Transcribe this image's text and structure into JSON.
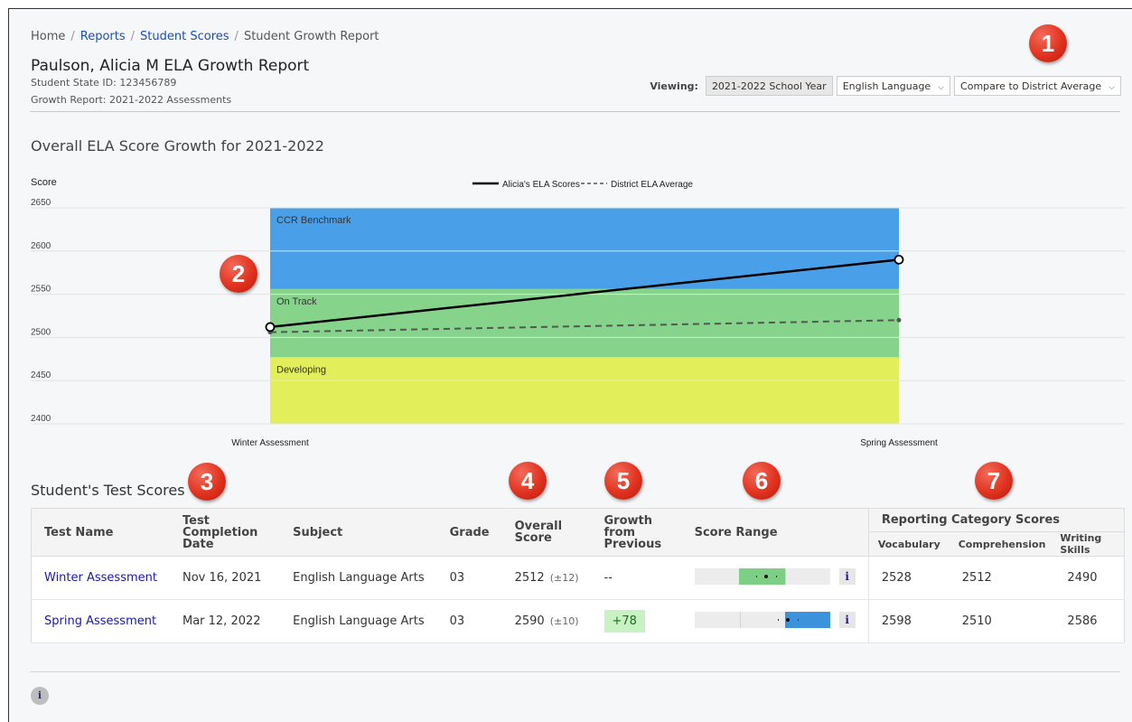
{
  "breadcrumb": {
    "home": "Home",
    "reports": "Reports",
    "student_scores": "Student Scores",
    "current": "Student Growth Report",
    "separator": "/"
  },
  "header": {
    "title": "Paulson, Alicia M ELA Growth Report",
    "state_id": "Student State ID: 123456789",
    "growth_report": "Growth Report: 2021-2022 Assessments"
  },
  "viewing": {
    "label": "Viewing:",
    "year": "2021-2022 School Year",
    "subject": "English Language",
    "compare": "Compare to District Average"
  },
  "chart_section_title": "Overall ELA Score Growth for 2021-2022",
  "chart_data": {
    "type": "line",
    "ylabel": "Score",
    "ylim": [
      2400,
      2650
    ],
    "yticks": [
      2650,
      2600,
      2550,
      2500,
      2450,
      2400
    ],
    "categories": [
      "Winter Assessment",
      "Spring  Assessment"
    ],
    "series": [
      {
        "name": "Alicia's ELA Scores",
        "values": [
          2512,
          2590
        ],
        "style": "solid",
        "color": "#000000"
      },
      {
        "name": "District ELA Average",
        "values": [
          2506,
          2520
        ],
        "style": "dashed",
        "color": "#555555"
      }
    ],
    "bands": [
      {
        "label": "CCR Benchmark",
        "from": 2556,
        "to": 2650,
        "color": "#4aa0e8"
      },
      {
        "label": "On Track",
        "from": 2477,
        "to": 2556,
        "color": "#86d38c"
      },
      {
        "label": "Developing",
        "from": 2400,
        "to": 2477,
        "color": "#e2ee5a"
      }
    ],
    "legend_position": "top"
  },
  "test_scores_title": "Student's Test Scores",
  "table": {
    "headers": {
      "test_name": "Test Name",
      "completion_date": "Test Completion Date",
      "subject": "Subject",
      "grade": "Grade",
      "overall": "Overall Score",
      "growth": "Growth from Previous",
      "range": "Score Range",
      "reporting": "Reporting Category Scores",
      "vocab": "Vocabulary",
      "comprehension": "Comprehension",
      "writing": "Writing Skills"
    },
    "rows": [
      {
        "test_name": "Winter Assessment",
        "date": "Nov 16, 2021",
        "subject": "English Language Arts",
        "grade": "03",
        "score": "2512",
        "pm": "(±12)",
        "growth": "--",
        "vocab": "2528",
        "comprehension": "2512",
        "writing": "2490",
        "range_color": "#7dcf85",
        "range_from": 0.33,
        "range_to": 0.67,
        "range_point": 0.53
      },
      {
        "test_name": "Spring Assessment",
        "date": "Mar 12, 2022",
        "subject": "English Language Arts",
        "grade": "03",
        "score": "2590",
        "pm": "(±10)",
        "growth": "+78",
        "vocab": "2598",
        "comprehension": "2510",
        "writing": "2586",
        "range_color": "#3d92dc",
        "range_from": 0.67,
        "range_to": 1.0,
        "range_point": 0.69
      }
    ],
    "info_glyph": "i"
  },
  "badges": [
    "1",
    "2",
    "3",
    "4",
    "5",
    "6",
    "7"
  ],
  "footer_info": "i"
}
